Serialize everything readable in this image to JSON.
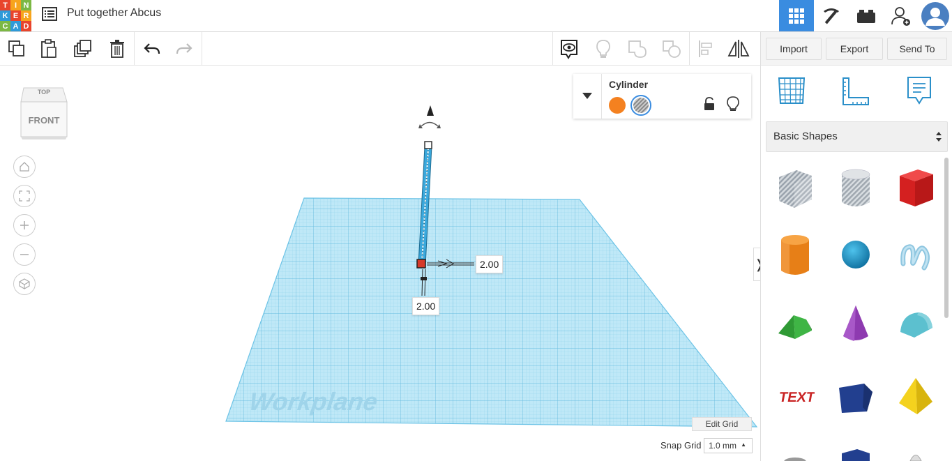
{
  "app": {
    "logo_letters": [
      "T",
      "I",
      "N",
      "K",
      "E",
      "R",
      "C",
      "A",
      "D"
    ],
    "logo_colors": [
      "#e8452c",
      "#f7a41d",
      "#7cb844",
      "#2f9ad8",
      "#e8452c",
      "#f7a41d",
      "#7cb844",
      "#2f9ad8",
      "#e8452c"
    ],
    "document_title": "Put together Abcus"
  },
  "header": {
    "views": [
      {
        "name": "3d-design-view",
        "icon": "grid-icon",
        "active": true
      },
      {
        "name": "blocks-view",
        "icon": "pickaxe-icon",
        "active": false
      },
      {
        "name": "bricks-view",
        "icon": "brick-icon",
        "active": false
      }
    ],
    "accent": "#3a8ce0"
  },
  "toolbar": {
    "import_label": "Import",
    "export_label": "Export",
    "send_to_label": "Send To"
  },
  "viewcube": {
    "top_label": "TOP",
    "front_label": "FRONT"
  },
  "inspector": {
    "shape_name": "Cylinder",
    "solid_color": "#f48120"
  },
  "canvas": {
    "workplane_label": "Workplane",
    "dim_x": "2.00",
    "dim_y": "2.00",
    "edit_grid_label": "Edit Grid",
    "snap_grid_label": "Snap Grid",
    "snap_grid_value": "1.0 mm"
  },
  "shapes_panel": {
    "category": "Basic Shapes",
    "items": [
      {
        "name": "box-hole",
        "icon": "box-hole-icon"
      },
      {
        "name": "cylinder-hole",
        "icon": "cylinder-hole-icon"
      },
      {
        "name": "box",
        "icon": "red-box-icon"
      },
      {
        "name": "cylinder",
        "icon": "orange-cylinder-icon"
      },
      {
        "name": "sphere",
        "icon": "blue-sphere-icon"
      },
      {
        "name": "scribble",
        "icon": "scribble-icon"
      },
      {
        "name": "roof",
        "icon": "green-roof-icon"
      },
      {
        "name": "cone",
        "icon": "purple-cone-icon"
      },
      {
        "name": "round-roof",
        "icon": "round-roof-icon"
      },
      {
        "name": "text",
        "icon": "text-icon"
      },
      {
        "name": "polygon",
        "icon": "polygon-icon"
      },
      {
        "name": "pyramid",
        "icon": "pyramid-icon"
      }
    ]
  }
}
